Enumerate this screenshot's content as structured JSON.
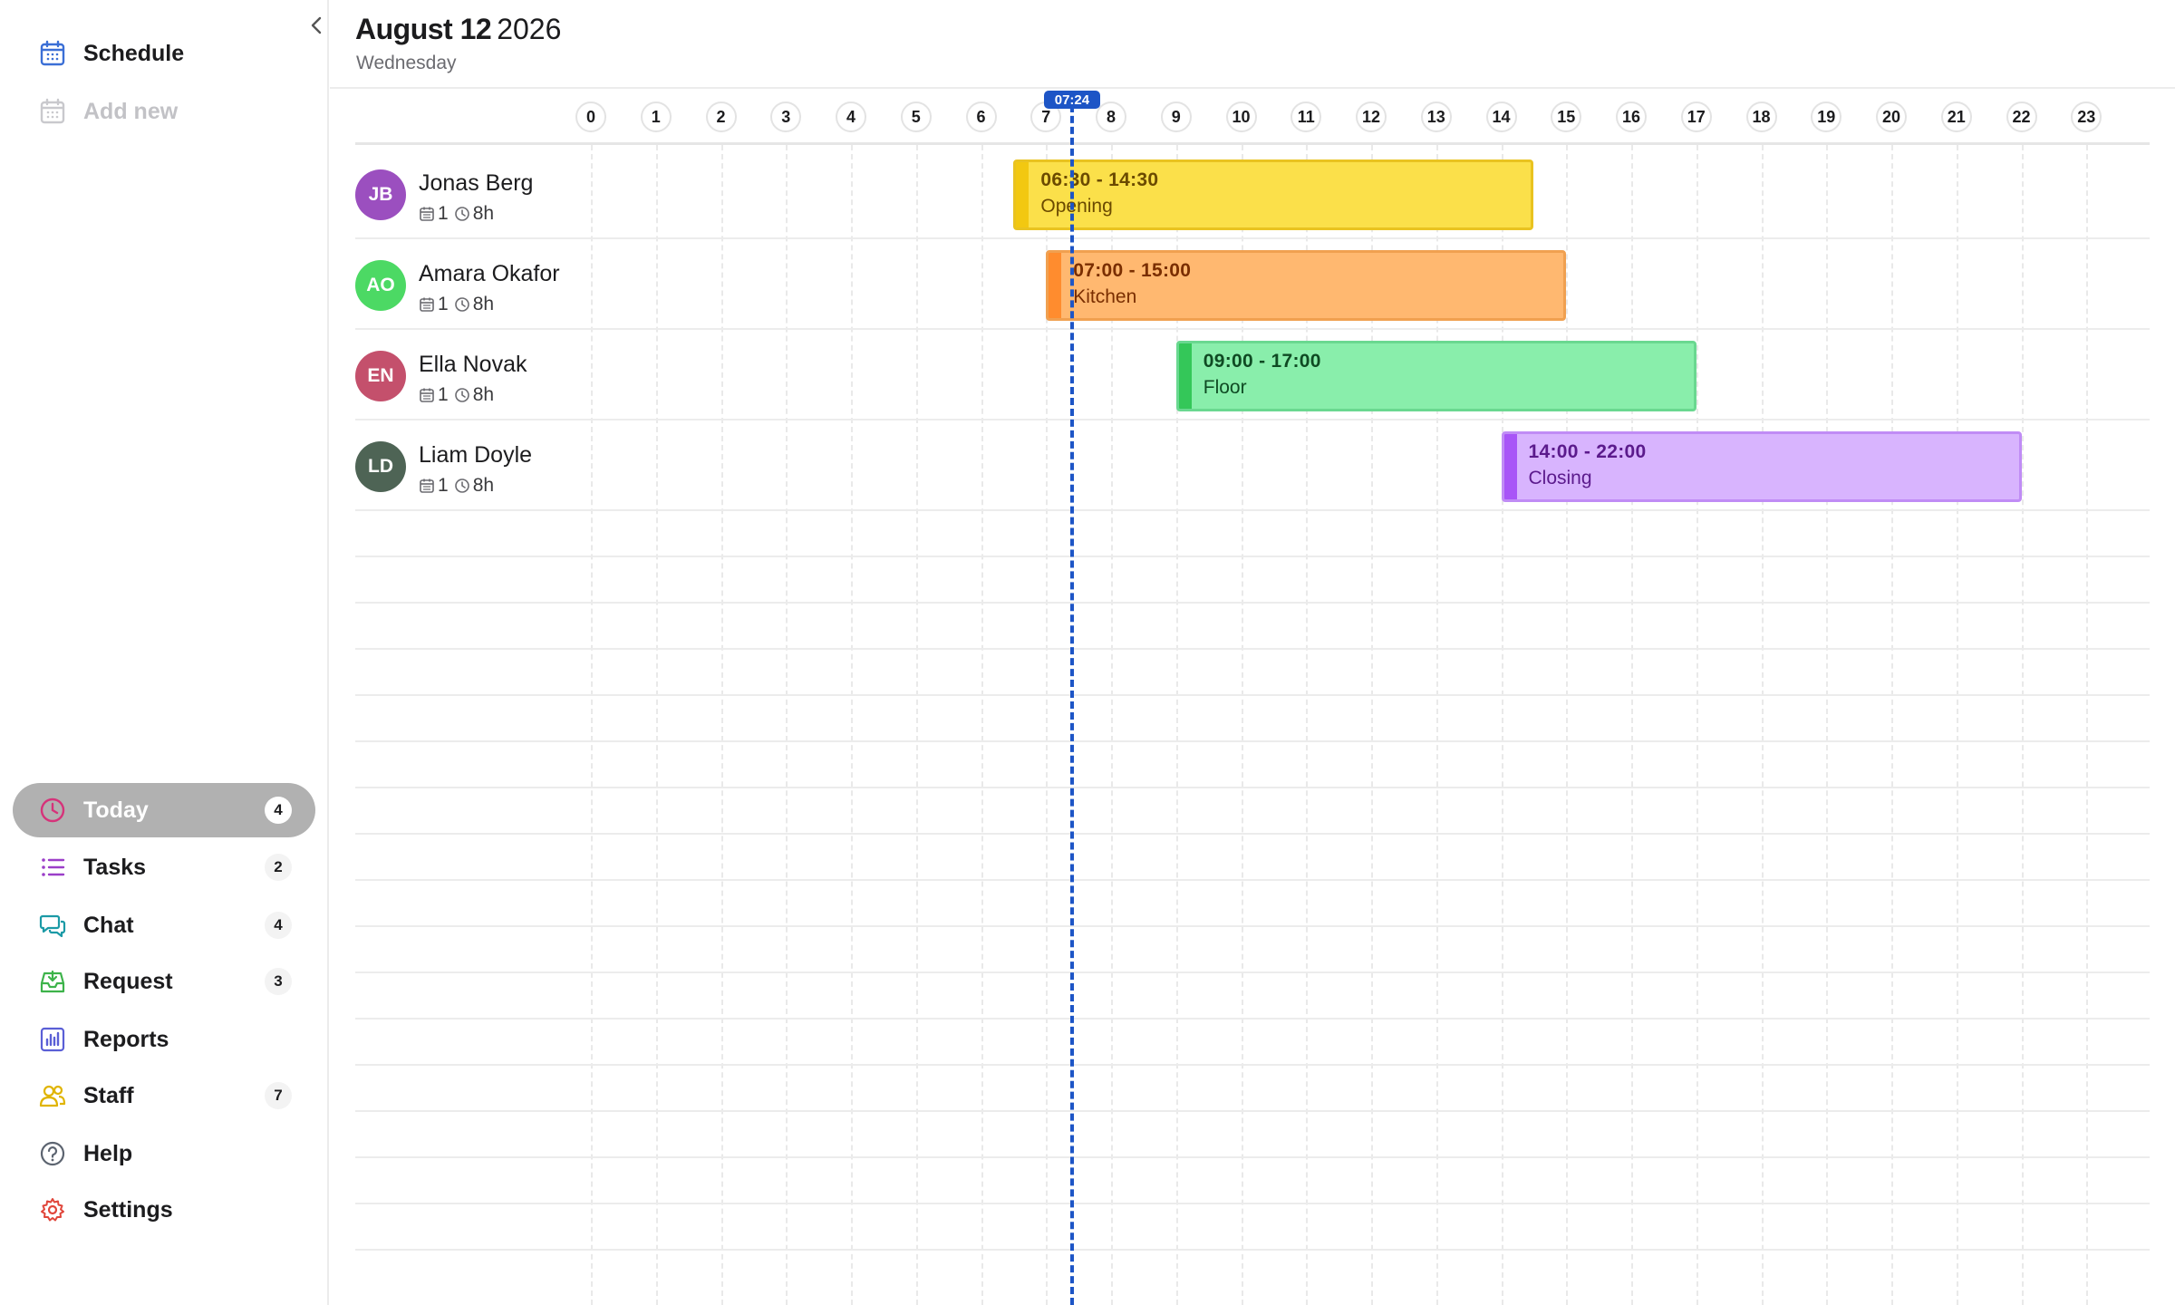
{
  "sidebar": {
    "top_items": [
      {
        "label": "Schedule",
        "icon": "calendar-icon"
      },
      {
        "label": "Add new",
        "icon": "calendar-plus-icon"
      }
    ],
    "items": [
      {
        "label": "Today",
        "icon": "clock-icon",
        "badge": "4",
        "active": true
      },
      {
        "label": "Tasks",
        "icon": "list-icon",
        "badge": "2"
      },
      {
        "label": "Chat",
        "icon": "chat-icon",
        "badge": "4"
      },
      {
        "label": "Request",
        "icon": "inbox-icon",
        "badge": "3"
      },
      {
        "label": "Reports",
        "icon": "bar-chart-icon"
      },
      {
        "label": "Staff",
        "icon": "users-icon",
        "badge": "7"
      },
      {
        "label": "Help",
        "icon": "help-icon"
      },
      {
        "label": "Settings",
        "icon": "gear-icon"
      }
    ]
  },
  "header": {
    "month_day": "August 12",
    "year": "2026",
    "weekday": "Wednesday"
  },
  "timeline": {
    "hours": [
      "0",
      "1",
      "2",
      "3",
      "4",
      "5",
      "6",
      "7",
      "8",
      "9",
      "10",
      "11",
      "12",
      "13",
      "14",
      "15",
      "16",
      "17",
      "18",
      "19",
      "20",
      "21",
      "22",
      "23"
    ],
    "now": "07:24",
    "now_hours": 7.4
  },
  "staff": [
    {
      "initials": "JB",
      "name": "Jonas Berg",
      "shifts_count": "1",
      "hours": "8h",
      "avatar_color": "#9b4fbf",
      "shift": {
        "time": "06:30 - 14:30",
        "role": "Opening",
        "start": 6.5,
        "end": 14.5,
        "fill": "#fbe04a",
        "border": "#e9c320",
        "edge": "#f2c811",
        "text": "#6b4a00"
      }
    },
    {
      "initials": "AO",
      "name": "Amara Okafor",
      "shifts_count": "1",
      "hours": "8h",
      "avatar_color": "#4cd964",
      "shift": {
        "time": "07:00 - 15:00",
        "role": "Kitchen",
        "start": 7.0,
        "end": 15.0,
        "fill": "#ffb870",
        "border": "#f0a050",
        "edge": "#ff8c2e",
        "text": "#7a2e00"
      }
    },
    {
      "initials": "EN",
      "name": "Ella Novak",
      "shifts_count": "1",
      "hours": "8h",
      "avatar_color": "#c4506c",
      "shift": {
        "time": "09:00 - 17:00",
        "role": "Floor",
        "start": 9.0,
        "end": 17.0,
        "fill": "#89eeab",
        "border": "#6ad890",
        "edge": "#34c759",
        "text": "#0f4a23"
      }
    },
    {
      "initials": "LD",
      "name": "Liam Doyle",
      "shifts_count": "1",
      "hours": "8h",
      "avatar_color": "#4e6455",
      "shift": {
        "time": "14:00 - 22:00",
        "role": "Closing",
        "start": 14.0,
        "end": 22.0,
        "fill": "#d8b4fe",
        "border": "#c08cf5",
        "edge": "#a855f7",
        "text": "#5b1a8c"
      }
    }
  ]
}
